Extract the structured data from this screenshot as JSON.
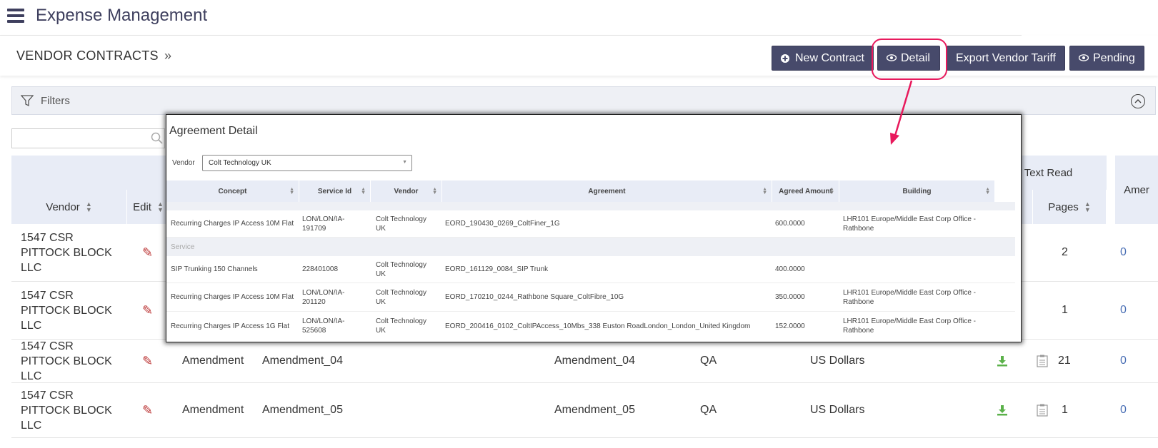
{
  "app": {
    "title": "Expense Management"
  },
  "page": {
    "title": "VENDOR CONTRACTS",
    "breadcrumb_sep": "»"
  },
  "toolbar": {
    "new_contract": "New Contract",
    "detail": "Detail",
    "export": "Export Vendor Tariff",
    "pending": "Pending"
  },
  "filters": {
    "label": "Filters"
  },
  "search": {
    "placeholder": ""
  },
  "grid": {
    "group_header": "Text Read",
    "right_header": "Amer",
    "columns": {
      "vendor": "Vendor",
      "edit": "Edit",
      "pages": "Pages"
    },
    "rows": [
      {
        "vendor": "1547 CSR PITTOCK BLOCK LLC",
        "type": "",
        "name": "",
        "name2": "",
        "env": "",
        "currency": "",
        "pages": "2",
        "amend": "0"
      },
      {
        "vendor": "1547 CSR PITTOCK BLOCK LLC",
        "type": "",
        "name": "",
        "name2": "",
        "env": "",
        "currency": "",
        "pages": "1",
        "amend": "0"
      },
      {
        "vendor": "1547 CSR PITTOCK BLOCK LLC",
        "type": "Amendment",
        "name": "Amendment_04",
        "name2": "Amendment_04",
        "env": "QA",
        "currency": "US Dollars",
        "pages": "21",
        "amend": "0"
      },
      {
        "vendor": "1547 CSR PITTOCK BLOCK LLC",
        "type": "Amendment",
        "name": "Amendment_05",
        "name2": "Amendment_05",
        "env": "QA",
        "currency": "US Dollars",
        "pages": "1",
        "amend": "0"
      }
    ]
  },
  "modal": {
    "title": "Agreement Detail",
    "vendor_label": "Vendor",
    "vendor_value": "Colt Technology UK",
    "columns": {
      "concept": "Concept",
      "service_id": "Service Id",
      "vendor": "Vendor",
      "agreement": "Agreement",
      "amount": "Agreed Amount",
      "building": "Building"
    },
    "group_label": "Service",
    "rows": [
      {
        "concept": "Recurring Charges IP Access 10M Flat",
        "service_id": "LON/LON/IA-191709",
        "vendor": "Colt Technology UK",
        "agreement": "EORD_190430_0269_ColtFiner_1G",
        "amount": "600.0000",
        "building": "LHR101 Europe/Middle East Corp Office - Rathbone"
      },
      {
        "concept": "SIP Trunking 150 Channels",
        "service_id": "228401008",
        "vendor": "Colt Technology UK",
        "agreement": "EORD_161129_0084_SIP Trunk",
        "amount": "400.0000",
        "building": ""
      },
      {
        "concept": "Recurring Charges IP Access 10M Flat",
        "service_id": "LON/LON/IA-201120",
        "vendor": "Colt Technology UK",
        "agreement": "EORD_170210_0244_Rathbone Square_ColtFibre_10G",
        "amount": "350.0000",
        "building": "LHR101 Europe/Middle East Corp Office - Rathbone"
      },
      {
        "concept": "Recurring Charges IP Access 1G Flat",
        "service_id": "LON/LON/IA-525608",
        "vendor": "Colt Technology UK",
        "agreement": "EORD_200416_0102_ColtIPAccess_10Mbs_338 Euston RoadLondon_London_United Kingdom",
        "amount": "152.0000",
        "building": "LHR101 Europe/Middle East Corp Office - Rathbone"
      }
    ]
  },
  "colors": {
    "primary_button": "#474a6b",
    "highlight": "#e8195c",
    "header_bg": "#e8ecf6"
  }
}
